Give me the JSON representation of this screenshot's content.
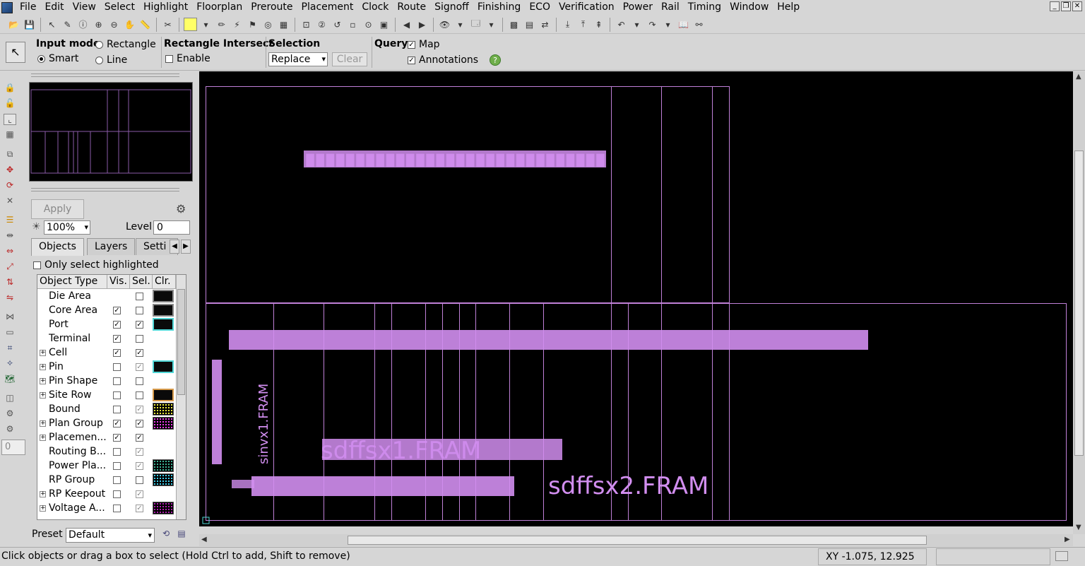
{
  "menu": [
    "File",
    "Edit",
    "View",
    "Select",
    "Highlight",
    "Floorplan",
    "Preroute",
    "Placement",
    "Clock",
    "Route",
    "Signoff",
    "Finishing",
    "ECO",
    "Verification",
    "Power",
    "Rail",
    "Timing",
    "Window",
    "Help"
  ],
  "options": {
    "input_mode": {
      "title": "Input mode",
      "rectangle": "Rectangle",
      "smart": "Smart",
      "line": "Line"
    },
    "rect_intersect": {
      "title": "Rectangle Intersect",
      "enable": "Enable"
    },
    "selection": {
      "title": "Selection",
      "value": "Replace",
      "clear": "Clear"
    },
    "query": {
      "title": "Query",
      "map": "Map",
      "annotations": "Annotations"
    }
  },
  "panel": {
    "apply": "Apply",
    "zoom": "100%",
    "level_label": "Level",
    "level_value": "0",
    "tabs": [
      "Objects",
      "Layers",
      "Setti"
    ],
    "only_select_highlighted": "Only select highlighted",
    "columns": [
      "Object Type",
      "Vis.",
      "Sel.",
      "Clr."
    ],
    "rows": [
      {
        "label": "Die Area",
        "exp": false,
        "vis": null,
        "sel": false,
        "clr": "#0a0a0a",
        "clrborder": "#888"
      },
      {
        "label": "Core Area",
        "exp": false,
        "vis": true,
        "sel": false,
        "clr": "#0a0a0a",
        "clrborder": "#888"
      },
      {
        "label": "Port",
        "exp": false,
        "vis": true,
        "sel": true,
        "clr": "#0a0a0a",
        "clrborder": "#4fd6d6"
      },
      {
        "label": "Terminal",
        "exp": false,
        "vis": true,
        "sel": false,
        "clr": "",
        "clrborder": ""
      },
      {
        "label": "Cell",
        "exp": true,
        "vis": true,
        "sel": true,
        "clr": "",
        "clrborder": ""
      },
      {
        "label": "Pin",
        "exp": true,
        "vis": false,
        "sel": "grey",
        "clr": "#0a0a0a",
        "clrborder": "#4fd6d6"
      },
      {
        "label": "Pin Shape",
        "exp": true,
        "vis": false,
        "sel": false,
        "clr": "",
        "clrborder": ""
      },
      {
        "label": "Site Row",
        "exp": true,
        "vis": false,
        "sel": false,
        "clr": "#0a0a0a",
        "clrborder": "#d79a4a"
      },
      {
        "label": "Bound",
        "exp": false,
        "vis": false,
        "sel": "grey",
        "clr": "dots-yellow",
        "clrborder": ""
      },
      {
        "label": "Plan Group",
        "exp": true,
        "vis": true,
        "sel": true,
        "clr": "dots-magenta",
        "clrborder": ""
      },
      {
        "label": "Placemen...",
        "exp": true,
        "vis": true,
        "sel": true,
        "clr": "",
        "clrborder": ""
      },
      {
        "label": "Routing B...",
        "exp": false,
        "vis": false,
        "sel": "grey",
        "clr": "",
        "clrborder": ""
      },
      {
        "label": "Power Pla...",
        "exp": false,
        "vis": false,
        "sel": "grey",
        "clr": "dots-teal",
        "clrborder": ""
      },
      {
        "label": "RP Group",
        "exp": false,
        "vis": false,
        "sel": false,
        "clr": "dots-cyan",
        "clrborder": ""
      },
      {
        "label": "RP Keepout",
        "exp": true,
        "vis": false,
        "sel": "grey",
        "clr": "",
        "clrborder": ""
      },
      {
        "label": "Voltage A...",
        "exp": true,
        "vis": false,
        "sel": "grey",
        "clr": "dots-magenta2",
        "clrborder": ""
      }
    ],
    "preset_label": "Preset",
    "preset_value": "Default"
  },
  "canvas": {
    "labels": {
      "top_blob": "ghostly overlapping cell name labels",
      "big1": "sdffsx2.FRAM",
      "big_overlap": "sdffsx1.FRAM",
      "vertical": "sinvx1.FRAM"
    },
    "colors": {
      "outline": "#c080d8",
      "label": "#d28ef0"
    }
  },
  "status": {
    "message": "Click objects or drag a box to select (Hold Ctrl to add, Shift to remove)",
    "xy": "XY -1.075, 12.925"
  },
  "left_level": "0"
}
